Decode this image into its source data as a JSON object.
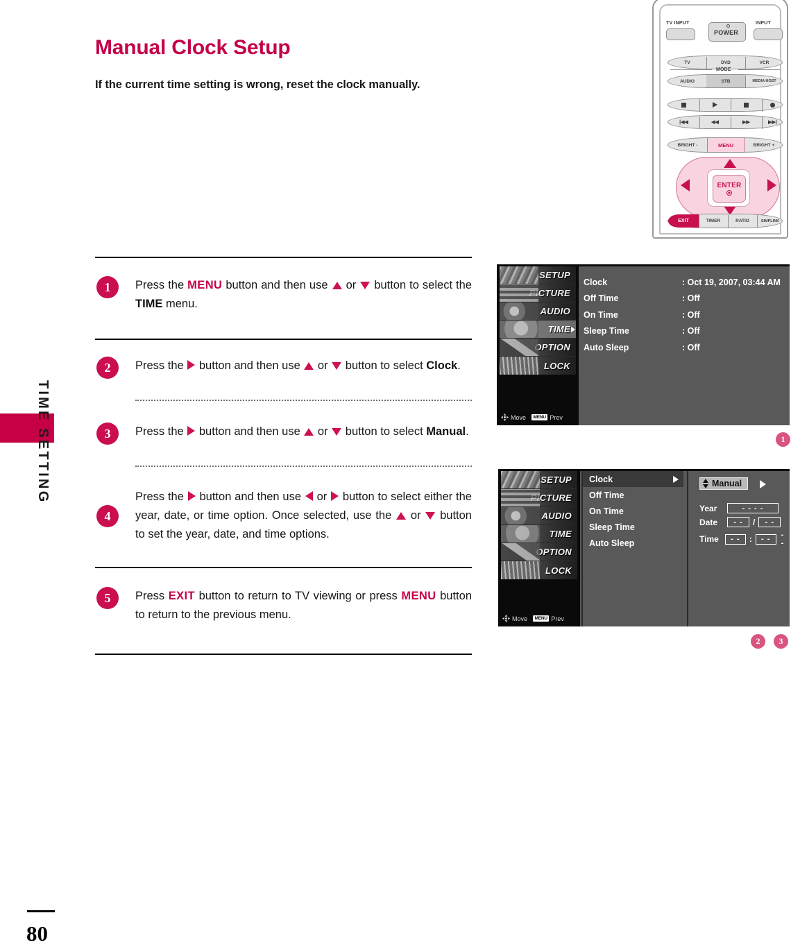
{
  "document": {
    "side_tab_label": "TIME SETTING",
    "page_number": "80",
    "title": "Manual Clock Setup",
    "subtitle": "If the current time setting is wrong, reset the clock manually."
  },
  "steps": [
    {
      "number": "1",
      "seg1": "Press the ",
      "kw1": "MENU",
      "seg2": " button and then use ",
      "seg3": " or ",
      "seg4": " button to select the ",
      "kw2": "TIME",
      "seg5": " menu."
    },
    {
      "number": "2",
      "seg1": "Press the ",
      "seg2": " button and then use ",
      "seg3": " or ",
      "seg4": " button to select ",
      "kw2": "Clock",
      "seg5": "."
    },
    {
      "number": "3",
      "seg1": "Press the ",
      "seg2": " button and then use ",
      "seg3": " or ",
      "seg4": " button to select ",
      "kw2": "Manual",
      "seg5": "."
    },
    {
      "number": "4",
      "seg1": "Press the ",
      "seg2": " button and then use ",
      "seg3": " or ",
      "seg4": " button to select either the year, date, or time option. Once selected, use the ",
      "seg5": " or ",
      "seg6": " button to set the year, date, and time options."
    },
    {
      "number": "5",
      "seg1": "Press ",
      "kw1": "EXIT",
      "seg2": " button to return to TV viewing or press ",
      "kw2": "MENU",
      "seg3": " button to return to the previous menu."
    }
  ],
  "remote": {
    "tv_input_label": "TV INPUT",
    "power_label": "POWER",
    "input_label": "INPUT",
    "mode_label": "MODE",
    "mode_row1": [
      "TV",
      "DVD",
      "VCR"
    ],
    "mode_row2": [
      "AUDIO",
      "STB",
      "MEDIA HOST"
    ],
    "bright_minus": "BRIGHT -",
    "menu": "MENU",
    "bright_plus": "BRIGHT +",
    "enter": "ENTER",
    "bottom_row": [
      "EXIT",
      "TIMER",
      "RATIO",
      "SIMPLINK"
    ]
  },
  "osd1": {
    "sidebar": [
      "SETUP",
      "PICTURE",
      "AUDIO",
      "TIME",
      "OPTION",
      "LOCK"
    ],
    "selected_sidebar": "TIME",
    "rows": [
      {
        "name": "Clock",
        "value": ": Oct 19, 2007, 03:44 AM"
      },
      {
        "name": "Off Time",
        "value": ": Off"
      },
      {
        "name": "On Time",
        "value": ": Off"
      },
      {
        "name": "Sleep Time",
        "value": ": Off"
      },
      {
        "name": "Auto Sleep",
        "value": ": Off"
      }
    ],
    "footer_move": "Move",
    "footer_menu_badge": "MENU",
    "footer_prev": "Prev"
  },
  "osd2": {
    "sidebar": [
      "SETUP",
      "PICTURE",
      "AUDIO",
      "TIME",
      "OPTION",
      "LOCK"
    ],
    "menu_items": [
      "Clock",
      "Off Time",
      "On Time",
      "Sleep Time",
      "Auto Sleep"
    ],
    "selected_menu_item": "Clock",
    "mode_value": "Manual",
    "fields": [
      {
        "label": "Year",
        "v1": "- - - -"
      },
      {
        "label": "Date",
        "v1": "- -",
        "sep": "/",
        "v2": "- -"
      },
      {
        "label": "Time",
        "v1": "- -",
        "sep": ":",
        "v2": "- -",
        "tail": "- -"
      }
    ],
    "footer_move": "Move",
    "footer_menu_badge": "MENU",
    "footer_prev": "Prev"
  },
  "markers": {
    "m1": "1",
    "m2": "2",
    "m3": "3"
  },
  "colors": {
    "brand_magenta": "#c4004a",
    "step_badge": "#ca0e50",
    "marker_pink": "#d9547e",
    "osd_bg": "#595959"
  }
}
